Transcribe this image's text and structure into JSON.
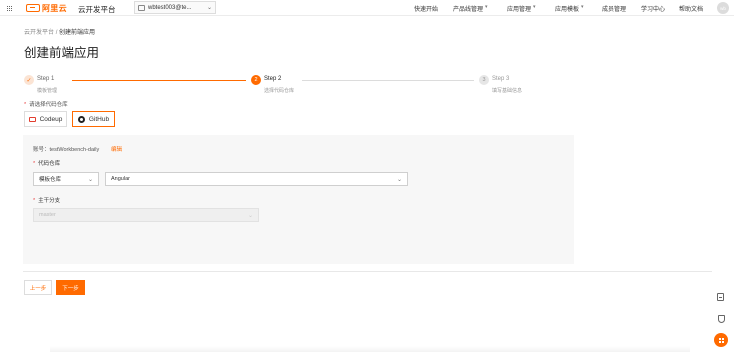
{
  "header": {
    "logo_text": "阿里云",
    "platform_name": "云开发平台",
    "workspace": "wbtest003@te...",
    "nav": [
      {
        "label": "快速开始",
        "dropdown": false
      },
      {
        "label": "产品线管理",
        "dropdown": true
      },
      {
        "label": "应用管理",
        "dropdown": true
      },
      {
        "label": "应用模板",
        "dropdown": true
      },
      {
        "label": "成员管理",
        "dropdown": false
      },
      {
        "label": "学习中心",
        "dropdown": false
      },
      {
        "label": "帮助文档",
        "dropdown": false
      }
    ],
    "avatar_text": "wb"
  },
  "breadcrumb": {
    "root": "云开发平台",
    "separator": "/",
    "current": "创建前端应用"
  },
  "page_title": "创建前端应用",
  "steps": [
    {
      "name": "Step 1",
      "desc": "模板管理",
      "status": "done"
    },
    {
      "name": "Step 2",
      "desc": "选择代码仓库",
      "status": "current",
      "number": "2"
    },
    {
      "name": "Step 3",
      "desc": "填写基础信息",
      "status": "pending",
      "number": "3"
    }
  ],
  "source": {
    "label": "请选择代码仓库",
    "options": [
      {
        "label": "Codeup",
        "icon": "codeup-icon",
        "selected": false
      },
      {
        "label": "GitHub",
        "icon": "github-icon",
        "selected": true
      }
    ]
  },
  "panel": {
    "account_label": "账号：",
    "account_value": "testWorkbench-daily",
    "edit_label": "编辑",
    "repo_label": "代码仓库",
    "repo_type": "模板仓库",
    "repo_name": "Angular",
    "branch_label": "主干分支",
    "branch_value": "master"
  },
  "footer": {
    "prev_label": "上一步",
    "next_label": "下一步"
  },
  "colors": {
    "accent": "#ff6a00",
    "required": "#e83e3e"
  }
}
